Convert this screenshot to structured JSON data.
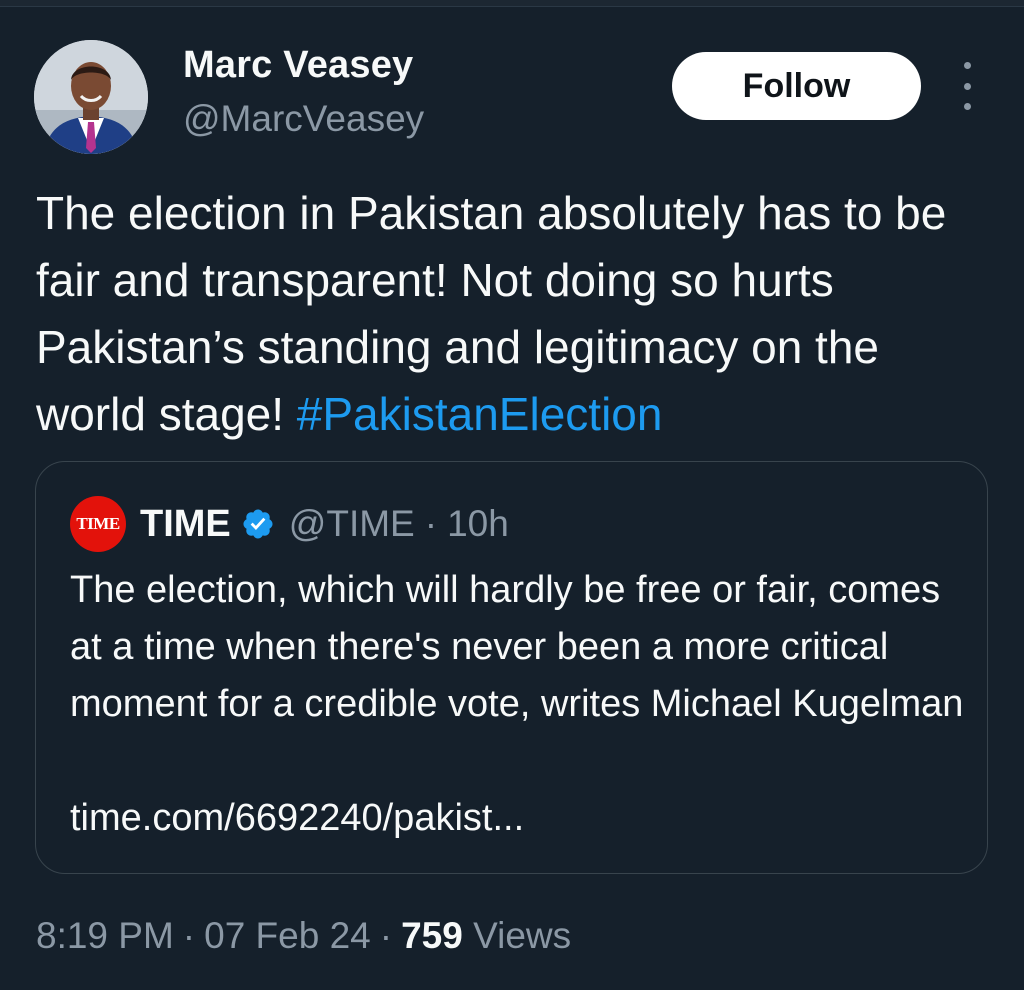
{
  "author": {
    "name": "Marc Veasey",
    "handle": "@MarcVeasey",
    "follow_label": "Follow"
  },
  "tweet": {
    "text": "The election in Pakistan absolutely has to be fair and transparent! Not doing so hurts Pakistan’s standing and legitimacy on the world stage! ",
    "hashtag": "#PakistanElection"
  },
  "quote": {
    "logo_text": "TIME",
    "name": "TIME",
    "handle": "@TIME",
    "dot": "·",
    "time": "10h",
    "text": "The election, which will hardly be free or fair, comes at a time when there's never been a more critical moment for a credible vote, writes Michael Kugelman",
    "link": "time.com/6692240/pakist..."
  },
  "meta": {
    "time": "8:19 PM",
    "date": "07 Feb 24",
    "views_count": "759",
    "views_label": "Views",
    "dot": "·"
  },
  "colors": {
    "background": "#15202b",
    "hashtag": "#1d9bf0",
    "verified": "#1d9bf0",
    "time_logo": "#e3120b",
    "secondary_text": "#8b98a5"
  },
  "icons": {
    "more": "more-vertical-icon",
    "verified": "verified-badge-icon"
  }
}
